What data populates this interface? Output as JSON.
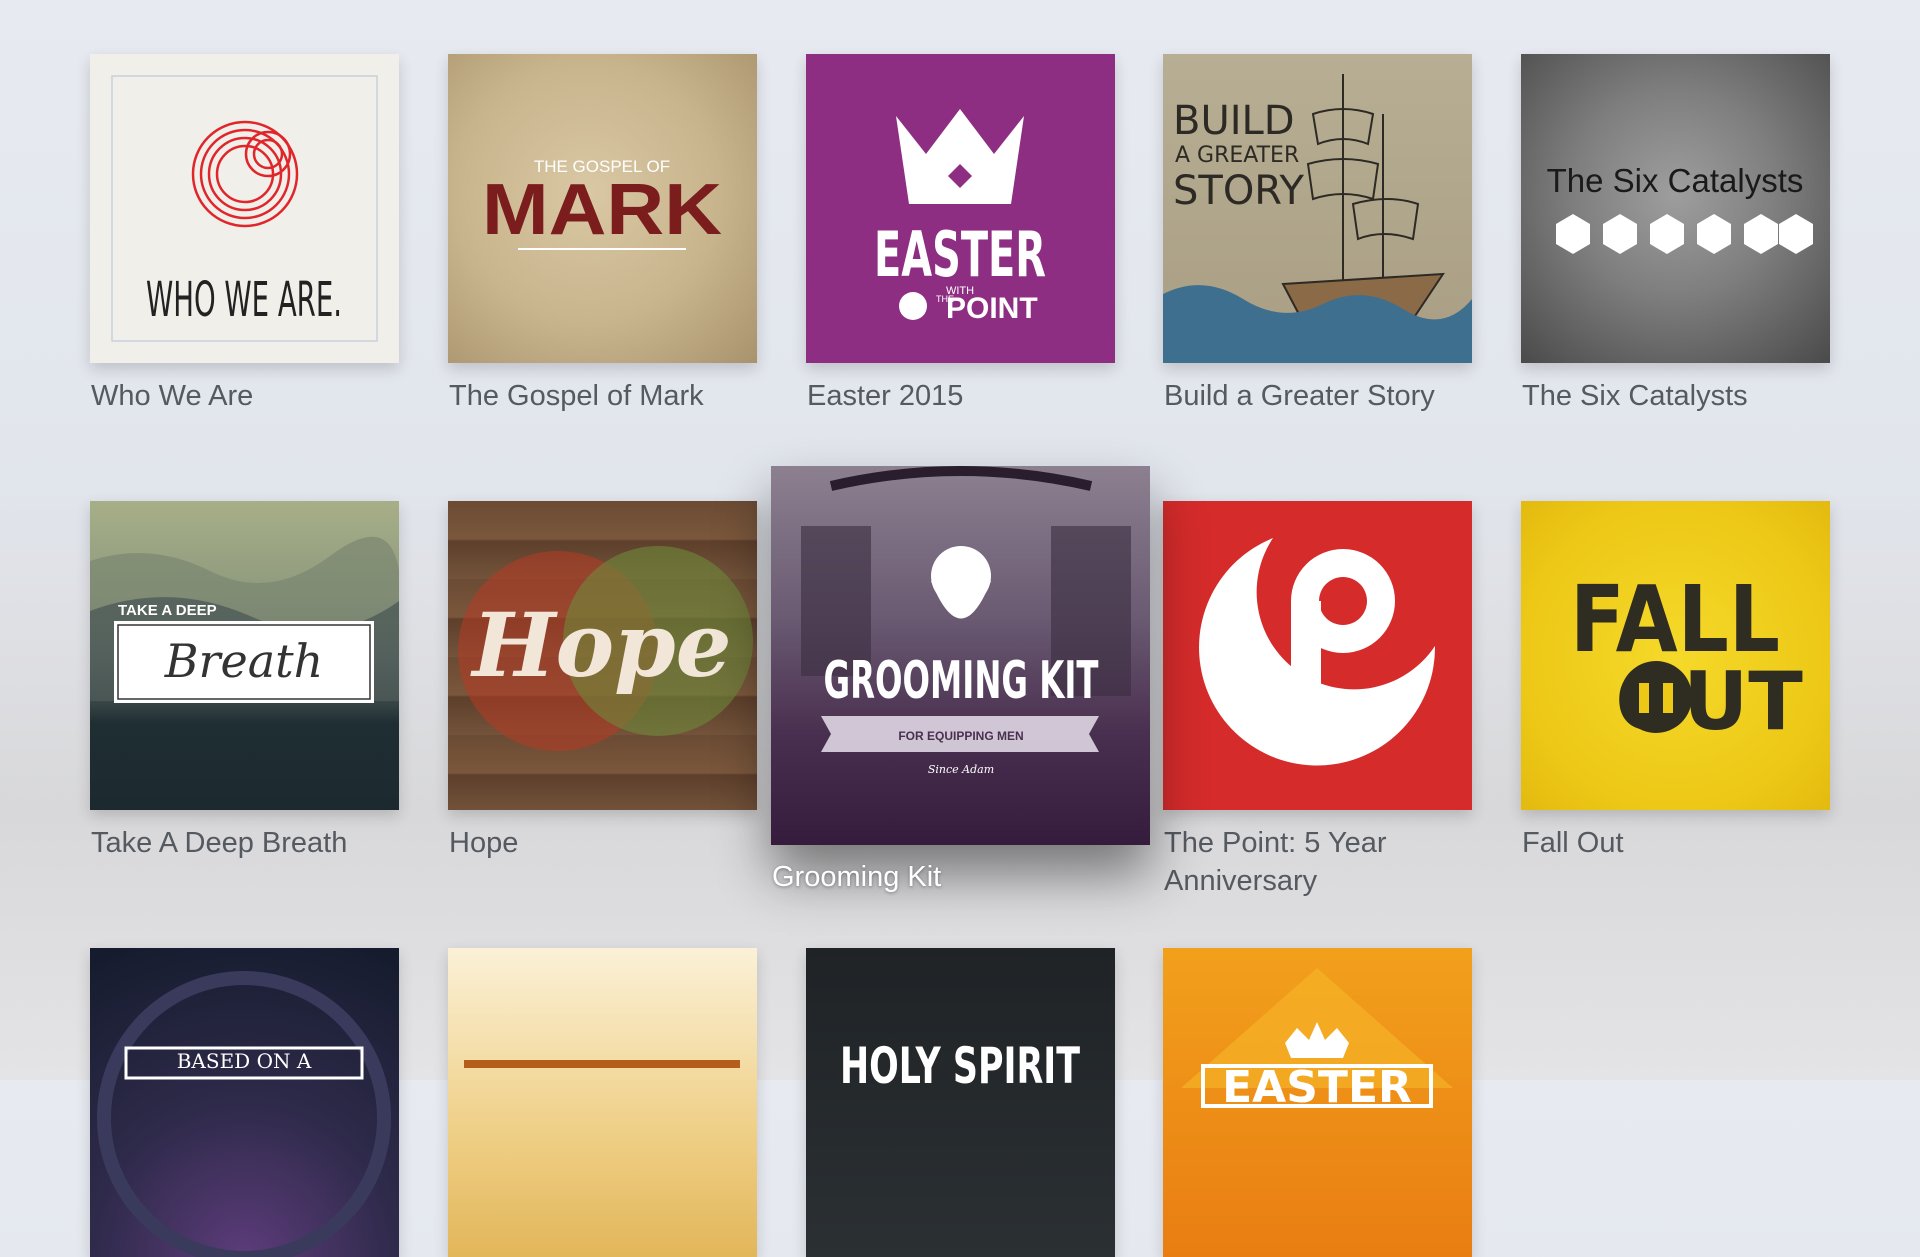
{
  "library": {
    "items": [
      {
        "title": "Who We Are",
        "art_text": "WHO WE ARE."
      },
      {
        "title": "The Gospel of Mark",
        "art_kicker": "THE GOSPEL OF",
        "art_text": "MARK"
      },
      {
        "title": "Easter 2015",
        "art_text": "EASTER",
        "art_with": "WITH",
        "art_brand": "POINT",
        "art_brand_small": "THE"
      },
      {
        "title": "Build a Greater Story",
        "art_line1": "BUILD",
        "art_line2": "A GREATER",
        "art_line3": "STORY"
      },
      {
        "title": "The Six Catalysts",
        "art_text": "The Six Catalysts"
      },
      {
        "title": "Take A Deep Breath",
        "art_kicker": "TAKE A DEEP",
        "art_text": "Breath"
      },
      {
        "title": "Hope",
        "art_text": "Hope"
      },
      {
        "title": "Grooming Kit",
        "art_text": "GROOMING KIT",
        "art_sub": "FOR EQUIPPING MEN",
        "art_since": "Since Adam"
      },
      {
        "title": "The Point: 5 Year Anniversary"
      },
      {
        "title": "Fall Out",
        "art_line1": "FALL",
        "art_line2": "OUT"
      },
      {
        "art_kicker": "BASED ON A"
      },
      {},
      {
        "art_text": "HOLY SPIRIT"
      },
      {
        "art_text": "EASTER"
      }
    ]
  },
  "colors": {
    "label_text": "#555a60",
    "easter_purple": "#8e2e83",
    "point_red": "#d52b2b",
    "fallout_yellow": "#f2d31a"
  },
  "focused_item": "Grooming Kit"
}
